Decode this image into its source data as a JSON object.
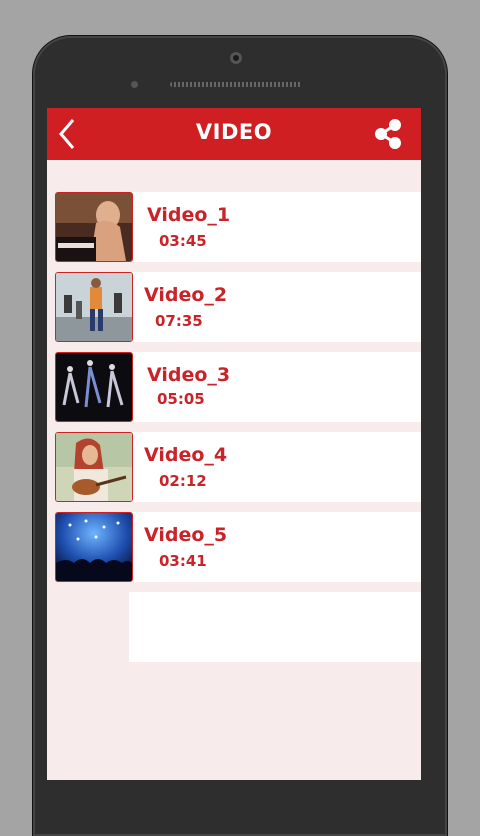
{
  "header": {
    "title": "VIDEO"
  },
  "videos": [
    {
      "name": "Video_1",
      "duration": "03:45"
    },
    {
      "name": "Video_2",
      "duration": "07:35"
    },
    {
      "name": "Video_3",
      "duration": "05:05"
    },
    {
      "name": "Video_4",
      "duration": "02:12"
    },
    {
      "name": "Video_5",
      "duration": "03:41"
    }
  ],
  "colors": {
    "accent": "#cf1f23",
    "background": "#f7ebeb",
    "text_accent": "#c8242a"
  },
  "icons": {
    "back": "back-arrow-icon",
    "share": "share-icon"
  }
}
